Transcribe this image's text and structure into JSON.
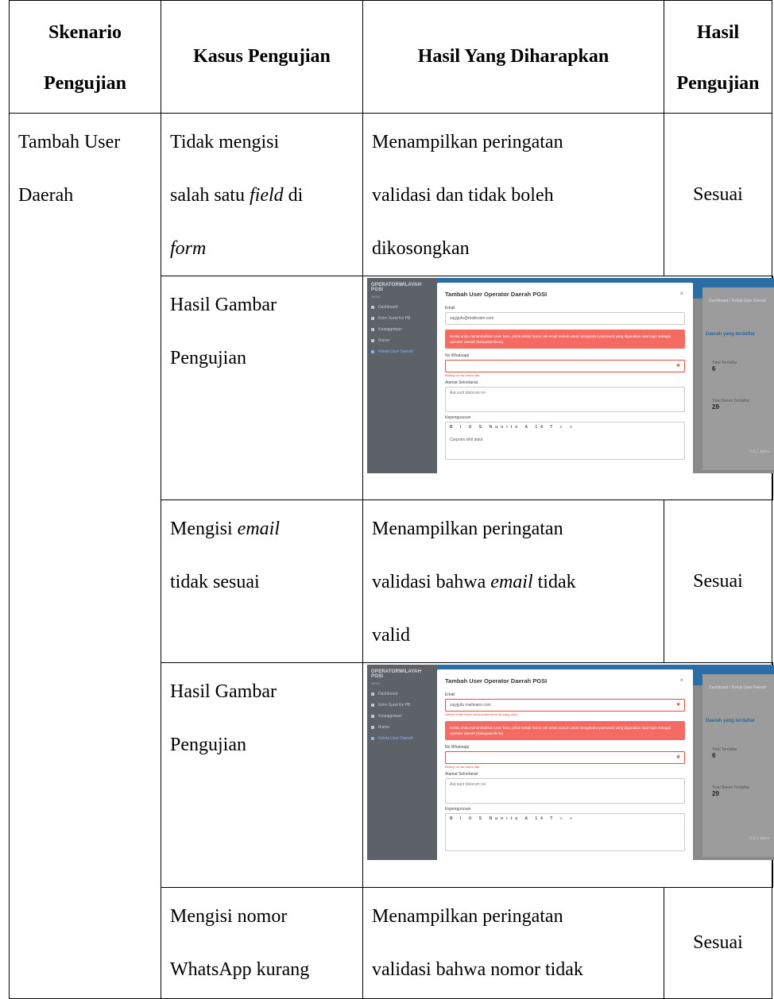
{
  "headers": {
    "col1": [
      "Skenario",
      "Pengujian"
    ],
    "col2": "Kasus Pengujian",
    "col3": "Hasil Yang Diharapkan",
    "col4": [
      "Hasil",
      "Pengujian"
    ]
  },
  "scenario": [
    "Tambah User",
    "Daerah"
  ],
  "rows": [
    {
      "case": [
        "Tidak mengisi",
        "salah satu field di",
        "form"
      ],
      "expected": [
        "Menampilkan peringatan",
        "validasi dan tidak boleh",
        "dikosongkan"
      ],
      "result": "Sesuai"
    },
    {
      "case": [
        "Mengisi email",
        "tidak sesuai"
      ],
      "expected": [
        "Menampilkan peringatan",
        "validasi bahwa email tidak",
        "valid"
      ],
      "result": "Sesuai"
    },
    {
      "case": [
        "Mengisi nomor",
        "WhatsApp kurang"
      ],
      "expected": [
        "Menampilkan peringatan",
        "validasi bahwa nomor tidak"
      ],
      "result": "Sesuai"
    }
  ],
  "image_label": [
    "Hasil Gambar",
    "Pengujian"
  ],
  "screenshot": {
    "brand": "OPERATORWILAYAH PGSI",
    "menu_header": "MENU",
    "menu": [
      "Dashboard",
      "Kirim Surat Ke PB",
      "Keanggotaan",
      "Iframe",
      "Kelola User Daerah"
    ],
    "modal_title": "Tambah User Operator Daerah PGSI",
    "close": "×",
    "email_label": "Email",
    "email_value_1": "zujyjjufu@mailinator.com",
    "email_value_2": "zujyjjufu mailinator.com",
    "email_error": "Alamat email harus berupa alamat email yang valid.",
    "alert_text": "Ketika anda menambahkan User baru, pihak terkait harus cek email masuk untuk mengetahui password yang digunakan saat login sebagai operator daerah (kabupaten/kota)",
    "wa_label": "No Whatsapp",
    "wa_error": "Bidang no wa harus diisi",
    "alamat_label": "Alamat Sekretariat",
    "alamat_placeholder": "Aut sunt dolorum rei",
    "kepengurusan_label": "Kepengurusan",
    "toolbar": "B I U S Nunito A 14 T ≡ ≡",
    "editor_text": "Corporis nihil dolor",
    "crumb": "Dashboard / Kelola User Daerah",
    "panel_title": "Daerah yang terdaftar",
    "stat1_label": "Total Terdaftar",
    "stat1_value": "6",
    "stat2_label": "Total Belum Terdaftar",
    "stat2_value": "29",
    "footer": "0.0.1 alpha"
  }
}
